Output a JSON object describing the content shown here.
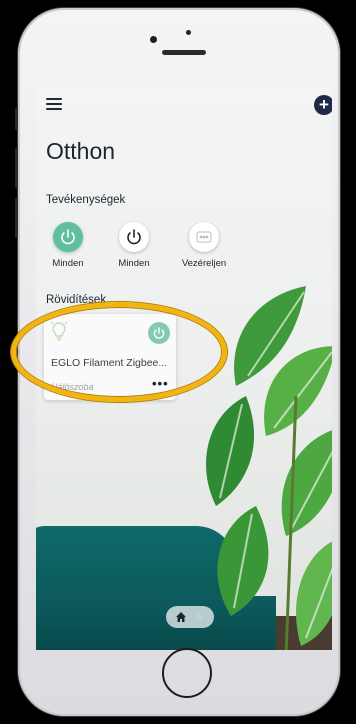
{
  "app": {
    "title": "Otthon"
  },
  "sections": {
    "activities_label": "Tevékenységek",
    "shortcuts_label": "Rövidítések"
  },
  "activities": [
    {
      "label": "Minden",
      "icon": "power-icon",
      "state": "on",
      "color": "#5fbfa0"
    },
    {
      "label": "Minden",
      "icon": "power-icon",
      "state": "off",
      "color": "#ffffff"
    },
    {
      "label": "Vezéreljen",
      "icon": "scene-control-icon",
      "state": "neutral",
      "color": "#ffffff"
    }
  ],
  "shortcut_card": {
    "device_name": "EGLO Filament Zigbee...",
    "room": "Hálószoba",
    "more_label": "•••",
    "icon": "lightbulb-icon",
    "power_color": "#6dc2a7"
  },
  "colors": {
    "accent": "#5fbfa0",
    "highlight": "#f2b40f",
    "header_icon": "#1f2b46"
  }
}
